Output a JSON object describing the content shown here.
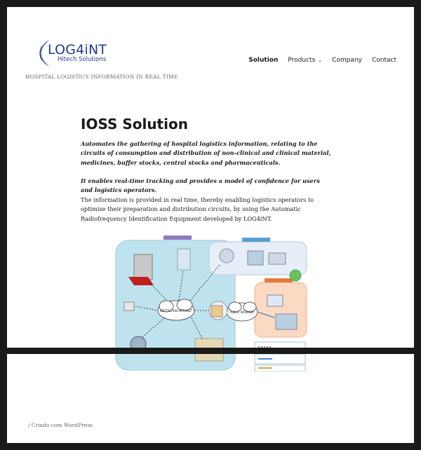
{
  "header": {
    "logo_text": "LOG4iNT",
    "logo_sub": "Hitech Solutions",
    "tagline": "HOSPITAL LOGISTICS INFORMATION IN REAL TIME"
  },
  "nav": {
    "items": [
      {
        "label": "Solution"
      },
      {
        "label": "Products"
      },
      {
        "label": "Company"
      },
      {
        "label": "Contact"
      }
    ]
  },
  "content": {
    "title": "IOSS Solution",
    "p1": "Automates the gathering of hospital logistics information, relating to the circuits of consumption and distribution of non-clinical and clinical material, medicines, buffer stocks, central stocks and pharmaceuticals.",
    "p2": "It enables real-time tracking and provides a model of confidence for users and logistics operators.",
    "p3": "The information is provided in real time, thereby enabling logistics operators to optimise their preparation and distribution circuits, by using the Automatic Radiofrequency Identification Equipment developed by LOG4iNT."
  },
  "diagram": {
    "intranet_label": "INSTITUTION INTRANET",
    "internet_label": "PUBLIC INTERNET"
  },
  "footer": {
    "credit": "/ Criado com WordPress"
  }
}
